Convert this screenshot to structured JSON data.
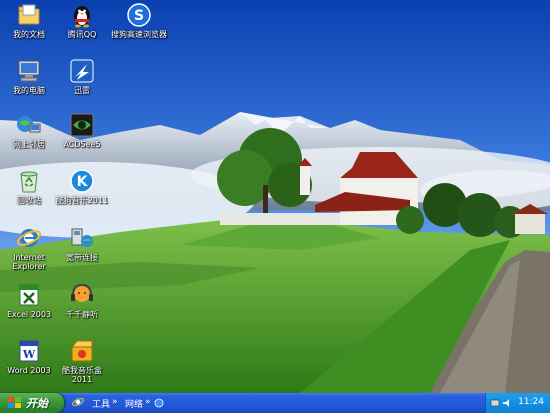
{
  "desktop_icons": [
    {
      "name": "my-documents",
      "label": "我的文档",
      "icon": "folder-icon"
    },
    {
      "name": "qq",
      "label": "腾讯QQ",
      "icon": "qq-penguin-icon"
    },
    {
      "name": "sogou-browser",
      "label": "搜狗高速浏览器",
      "icon": "sogou-s-icon"
    },
    {
      "name": "my-computer",
      "label": "我的电脑",
      "icon": "computer-icon"
    },
    {
      "name": "xunlei",
      "label": "迅雷",
      "icon": "thunder-icon"
    },
    {
      "name": "network-neighborhood",
      "label": "网上邻居",
      "icon": "network-icon"
    },
    {
      "name": "acdsee",
      "label": "ACDSee5",
      "icon": "eye-icon"
    },
    {
      "name": "recycle-bin",
      "label": "回收站",
      "icon": "recycle-bin-icon"
    },
    {
      "name": "kugou",
      "label": "酷狗音乐2011",
      "icon": "kugou-k-icon"
    },
    {
      "name": "internet-explorer",
      "label": "Internet Explorer",
      "icon": "ie-icon"
    },
    {
      "name": "broadband",
      "label": "宽带连接",
      "icon": "broadband-icon"
    },
    {
      "name": "excel",
      "label": "Excel 2003",
      "icon": "excel-icon"
    },
    {
      "name": "ttplayer",
      "label": "千千静听",
      "icon": "ttplayer-icon"
    },
    {
      "name": "word",
      "label": "Word 2003",
      "icon": "word-icon"
    },
    {
      "name": "kuwo",
      "label": "酷我音乐盒2011",
      "icon": "music-box-icon"
    }
  ],
  "taskbar": {
    "start_label": "开始",
    "toolbar_tools": "工具",
    "toolbar_network": "网络",
    "clock": "11:24"
  }
}
